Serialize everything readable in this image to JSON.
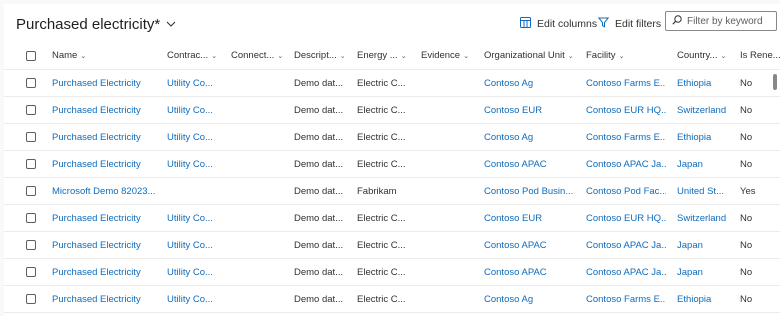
{
  "view": {
    "title": "Purchased electricity*"
  },
  "toolbar": {
    "edit_columns": "Edit columns",
    "edit_filters": "Edit filters",
    "search_placeholder": "Filter by keyword"
  },
  "columns": [
    "Name",
    "Contrac...",
    "Connect...",
    "Descript...",
    "Energy ...",
    "Evidence",
    "Organizational Unit",
    "Facility",
    "Country...",
    "Is Rene..."
  ],
  "rows": [
    {
      "name": "Purchased Electricity",
      "contract": "Utility Co...",
      "connection": "",
      "description": "Demo dat...",
      "energy": "Electric C...",
      "evidence": "",
      "org_unit": "Contoso Ag",
      "facility": "Contoso Farms E...",
      "country": "Ethiopia",
      "renewable": "No"
    },
    {
      "name": "Purchased Electricity",
      "contract": "Utility Co...",
      "connection": "",
      "description": "Demo dat...",
      "energy": "Electric C...",
      "evidence": "",
      "org_unit": "Contoso EUR",
      "facility": "Contoso EUR HQ...",
      "country": "Switzerland",
      "renewable": "No"
    },
    {
      "name": "Purchased Electricity",
      "contract": "Utility Co...",
      "connection": "",
      "description": "Demo dat...",
      "energy": "Electric C...",
      "evidence": "",
      "org_unit": "Contoso Ag",
      "facility": "Contoso Farms E...",
      "country": "Ethiopia",
      "renewable": "No"
    },
    {
      "name": "Purchased Electricity",
      "contract": "Utility Co...",
      "connection": "",
      "description": "Demo dat...",
      "energy": "Electric C...",
      "evidence": "",
      "org_unit": "Contoso APAC",
      "facility": "Contoso APAC Ja...",
      "country": "Japan",
      "renewable": "No"
    },
    {
      "name": "Microsoft Demo 82023...",
      "contract": "",
      "connection": "",
      "description": "Demo dat...",
      "energy": "Fabrikam",
      "evidence": "",
      "org_unit": "Contoso Pod Busin...",
      "facility": "Contoso Pod Fac...",
      "country": "United St...",
      "renewable": "Yes"
    },
    {
      "name": "Purchased Electricity",
      "contract": "Utility Co...",
      "connection": "",
      "description": "Demo dat...",
      "energy": "Electric C...",
      "evidence": "",
      "org_unit": "Contoso EUR",
      "facility": "Contoso EUR HQ...",
      "country": "Switzerland",
      "renewable": "No"
    },
    {
      "name": "Purchased Electricity",
      "contract": "Utility Co...",
      "connection": "",
      "description": "Demo dat...",
      "energy": "Electric C...",
      "evidence": "",
      "org_unit": "Contoso APAC",
      "facility": "Contoso APAC Ja...",
      "country": "Japan",
      "renewable": "No"
    },
    {
      "name": "Purchased Electricity",
      "contract": "Utility Co...",
      "connection": "",
      "description": "Demo dat...",
      "energy": "Electric C...",
      "evidence": "",
      "org_unit": "Contoso APAC",
      "facility": "Contoso APAC Ja...",
      "country": "Japan",
      "renewable": "No"
    },
    {
      "name": "Purchased Electricity",
      "contract": "Utility Co...",
      "connection": "",
      "description": "Demo dat...",
      "energy": "Electric C...",
      "evidence": "",
      "org_unit": "Contoso Ag",
      "facility": "Contoso Farms E...",
      "country": "Ethiopia",
      "renewable": "No"
    }
  ],
  "colors": {
    "link": "#0f6cbd",
    "text": "#323130",
    "border": "#edebe9"
  },
  "icons": {
    "view_selector": "chevron-down-icon",
    "edit_columns": "edit-columns-icon",
    "edit_filters": "filter-icon",
    "search": "search-icon"
  }
}
